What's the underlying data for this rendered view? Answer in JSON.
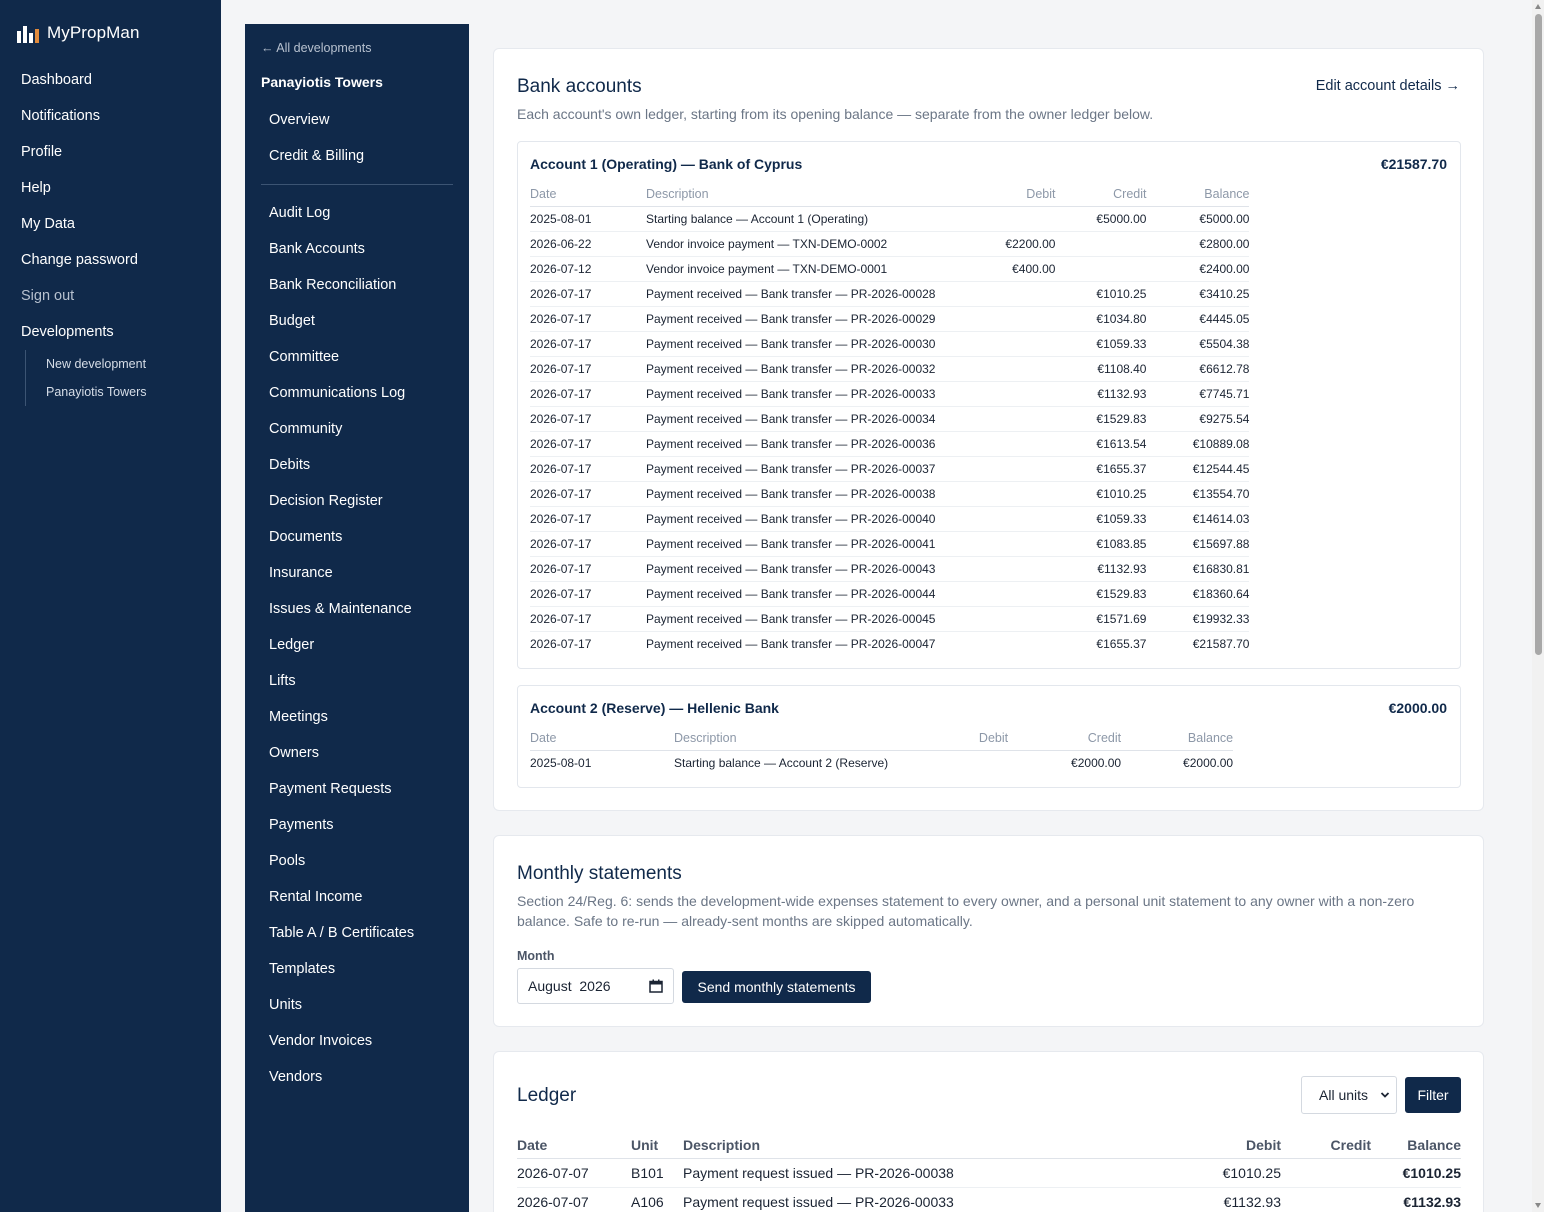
{
  "app": {
    "name": "MyPropMan",
    "logo_icon": "bar-chart-logo-icon"
  },
  "sidebar": {
    "items": [
      {
        "label": "Dashboard"
      },
      {
        "label": "Notifications"
      },
      {
        "label": "Profile"
      },
      {
        "label": "Help"
      },
      {
        "label": "My Data"
      },
      {
        "label": "Change password"
      },
      {
        "label": "Sign out"
      },
      {
        "label": "Developments"
      }
    ],
    "sub_items": [
      {
        "label": "New development"
      },
      {
        "label": "Panayiotis Towers"
      }
    ]
  },
  "development_nav": {
    "back_label": "← All developments",
    "title": "Panayiotis Towers",
    "primary": [
      {
        "label": "Overview"
      },
      {
        "label": "Credit & Billing"
      }
    ],
    "sections": [
      {
        "label": "Audit Log"
      },
      {
        "label": "Bank Accounts"
      },
      {
        "label": "Bank Reconciliation"
      },
      {
        "label": "Budget"
      },
      {
        "label": "Committee"
      },
      {
        "label": "Communications Log"
      },
      {
        "label": "Community"
      },
      {
        "label": "Debits"
      },
      {
        "label": "Decision Register"
      },
      {
        "label": "Documents"
      },
      {
        "label": "Insurance"
      },
      {
        "label": "Issues & Maintenance"
      },
      {
        "label": "Ledger"
      },
      {
        "label": "Lifts"
      },
      {
        "label": "Meetings"
      },
      {
        "label": "Owners"
      },
      {
        "label": "Payment Requests"
      },
      {
        "label": "Payments"
      },
      {
        "label": "Pools"
      },
      {
        "label": "Rental Income"
      },
      {
        "label": "Table A / B Certificates"
      },
      {
        "label": "Templates"
      },
      {
        "label": "Units"
      },
      {
        "label": "Vendor Invoices"
      },
      {
        "label": "Vendors"
      }
    ]
  },
  "bank_accounts": {
    "title": "Bank accounts",
    "edit_link": "Edit account details →",
    "subtitle": "Each account's own ledger, starting from its opening balance — separate from the owner ledger below.",
    "columns": {
      "date": "Date",
      "description": "Description",
      "debit": "Debit",
      "credit": "Credit",
      "balance": "Balance"
    },
    "accounts": [
      {
        "name": "Account 1 (Operating) — Bank of Cyprus",
        "balance": "€21587.70",
        "rows": [
          {
            "date": "2025-08-01",
            "description": "Starting balance — Account 1 (Operating)",
            "debit": "",
            "credit": "€5000.00",
            "balance": "€5000.00"
          },
          {
            "date": "2026-06-22",
            "description": "Vendor invoice payment — TXN-DEMO-0002",
            "debit": "€2200.00",
            "credit": "",
            "balance": "€2800.00"
          },
          {
            "date": "2026-07-12",
            "description": "Vendor invoice payment — TXN-DEMO-0001",
            "debit": "€400.00",
            "credit": "",
            "balance": "€2400.00"
          },
          {
            "date": "2026-07-17",
            "description": "Payment received — Bank transfer — PR-2026-00028",
            "debit": "",
            "credit": "€1010.25",
            "balance": "€3410.25"
          },
          {
            "date": "2026-07-17",
            "description": "Payment received — Bank transfer — PR-2026-00029",
            "debit": "",
            "credit": "€1034.80",
            "balance": "€4445.05"
          },
          {
            "date": "2026-07-17",
            "description": "Payment received — Bank transfer — PR-2026-00030",
            "debit": "",
            "credit": "€1059.33",
            "balance": "€5504.38"
          },
          {
            "date": "2026-07-17",
            "description": "Payment received — Bank transfer — PR-2026-00032",
            "debit": "",
            "credit": "€1108.40",
            "balance": "€6612.78"
          },
          {
            "date": "2026-07-17",
            "description": "Payment received — Bank transfer — PR-2026-00033",
            "debit": "",
            "credit": "€1132.93",
            "balance": "€7745.71"
          },
          {
            "date": "2026-07-17",
            "description": "Payment received — Bank transfer — PR-2026-00034",
            "debit": "",
            "credit": "€1529.83",
            "balance": "€9275.54"
          },
          {
            "date": "2026-07-17",
            "description": "Payment received — Bank transfer — PR-2026-00036",
            "debit": "",
            "credit": "€1613.54",
            "balance": "€10889.08"
          },
          {
            "date": "2026-07-17",
            "description": "Payment received — Bank transfer — PR-2026-00037",
            "debit": "",
            "credit": "€1655.37",
            "balance": "€12544.45"
          },
          {
            "date": "2026-07-17",
            "description": "Payment received — Bank transfer — PR-2026-00038",
            "debit": "",
            "credit": "€1010.25",
            "balance": "€13554.70"
          },
          {
            "date": "2026-07-17",
            "description": "Payment received — Bank transfer — PR-2026-00040",
            "debit": "",
            "credit": "€1059.33",
            "balance": "€14614.03"
          },
          {
            "date": "2026-07-17",
            "description": "Payment received — Bank transfer — PR-2026-00041",
            "debit": "",
            "credit": "€1083.85",
            "balance": "€15697.88"
          },
          {
            "date": "2026-07-17",
            "description": "Payment received — Bank transfer — PR-2026-00043",
            "debit": "",
            "credit": "€1132.93",
            "balance": "€16830.81"
          },
          {
            "date": "2026-07-17",
            "description": "Payment received — Bank transfer — PR-2026-00044",
            "debit": "",
            "credit": "€1529.83",
            "balance": "€18360.64"
          },
          {
            "date": "2026-07-17",
            "description": "Payment received — Bank transfer — PR-2026-00045",
            "debit": "",
            "credit": "€1571.69",
            "balance": "€19932.33"
          },
          {
            "date": "2026-07-17",
            "description": "Payment received — Bank transfer — PR-2026-00047",
            "debit": "",
            "credit": "€1655.37",
            "balance": "€21587.70"
          }
        ]
      },
      {
        "name": "Account 2 (Reserve) — Hellenic Bank",
        "balance": "€2000.00",
        "rows": [
          {
            "date": "2025-08-01",
            "description": "Starting balance — Account 2 (Reserve)",
            "debit": "",
            "credit": "€2000.00",
            "balance": "€2000.00"
          }
        ]
      }
    ]
  },
  "monthly_statements": {
    "title": "Monthly statements",
    "description": "Section 24/Reg. 6: sends the development-wide expenses statement to every owner, and a personal unit statement to any owner with a non-zero balance. Safe to re-run — already-sent months are skipped automatically.",
    "month_label": "Month",
    "month_value": "August  2026",
    "send_button": "Send monthly statements"
  },
  "ledger": {
    "title": "Ledger",
    "unit_filter": "All units",
    "filter_button": "Filter",
    "columns": {
      "date": "Date",
      "unit": "Unit",
      "description": "Description",
      "debit": "Debit",
      "credit": "Credit",
      "balance": "Balance"
    },
    "rows": [
      {
        "date": "2026-07-07",
        "unit": "B101",
        "description": "Payment request issued — PR-2026-00038",
        "debit": "€1010.25",
        "credit": "",
        "balance": "€1010.25"
      },
      {
        "date": "2026-07-07",
        "unit": "A106",
        "description": "Payment request issued — PR-2026-00033",
        "debit": "€1132.93",
        "credit": "",
        "balance": "€1132.93"
      }
    ]
  },
  "colors": {
    "navy": "#10294a",
    "page_bg": "#f4f5f7"
  }
}
